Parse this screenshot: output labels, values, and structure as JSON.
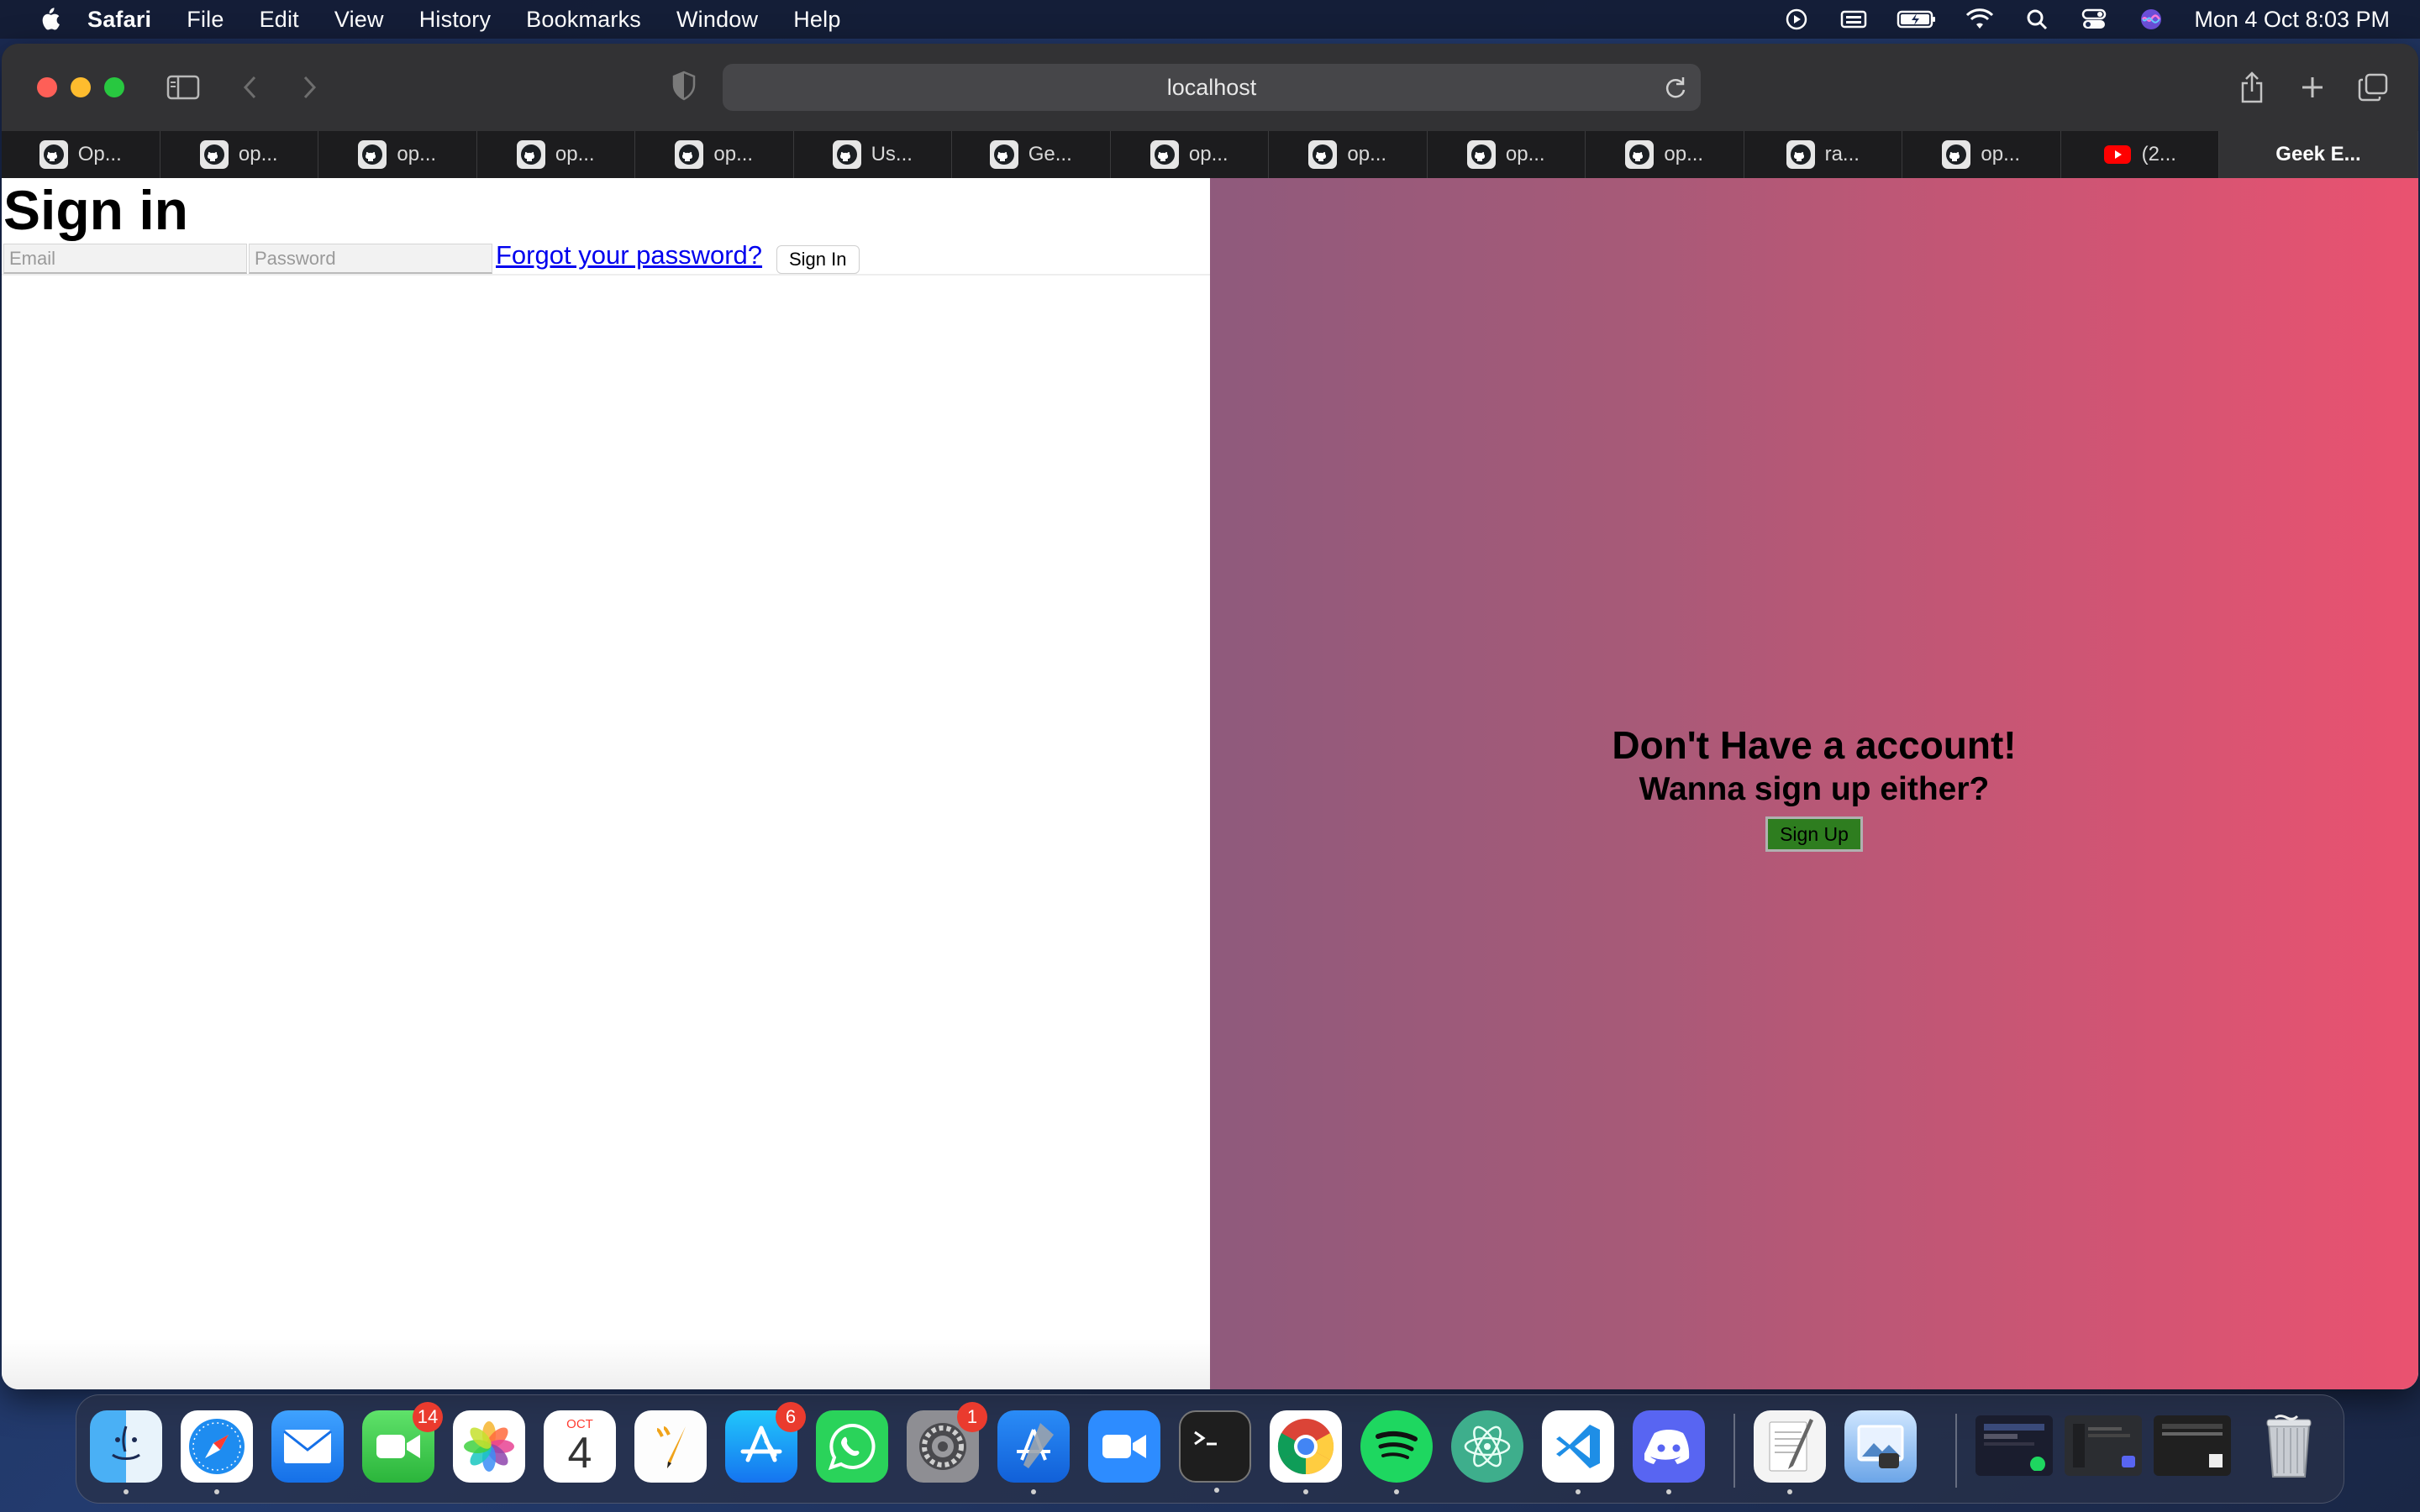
{
  "menubar": {
    "app_name": "Safari",
    "items": [
      "File",
      "Edit",
      "View",
      "History",
      "Bookmarks",
      "Window",
      "Help"
    ],
    "clock": "Mon 4 Oct  8:03 PM",
    "status_icons": [
      "screen-record-icon",
      "keyboard-input-icon",
      "battery-charging-icon",
      "wifi-icon",
      "spotlight-search-icon",
      "control-center-icon",
      "siri-icon"
    ]
  },
  "browser": {
    "address": "localhost",
    "tabs": [
      {
        "label": "Op...",
        "icon": "github-icon"
      },
      {
        "label": "op...",
        "icon": "github-icon"
      },
      {
        "label": "op...",
        "icon": "github-icon"
      },
      {
        "label": "op...",
        "icon": "github-icon"
      },
      {
        "label": "op...",
        "icon": "github-icon"
      },
      {
        "label": "Us...",
        "icon": "github-icon"
      },
      {
        "label": "Ge...",
        "icon": "github-icon"
      },
      {
        "label": "op...",
        "icon": "github-icon"
      },
      {
        "label": "op...",
        "icon": "github-icon"
      },
      {
        "label": "op...",
        "icon": "github-icon"
      },
      {
        "label": "op...",
        "icon": "github-icon"
      },
      {
        "label": "ra...",
        "icon": "github-icon"
      },
      {
        "label": "op...",
        "icon": "github-icon"
      },
      {
        "label": "(2...",
        "icon": "youtube-icon"
      }
    ],
    "active_tab": "Geek E..."
  },
  "page": {
    "signin": {
      "title": "Sign in",
      "email_placeholder": "Email",
      "password_placeholder": "Password",
      "forgot_link": "Forgot your password?",
      "signin_button": "Sign In"
    },
    "signup_promo": {
      "heading": "Don't Have a account!",
      "subheading": "Wanna sign up either?",
      "signup_button": "Sign Up"
    }
  },
  "dock": {
    "apps": [
      {
        "name": "Finder",
        "icon": "finder-icon",
        "running": true
      },
      {
        "name": "Safari",
        "icon": "safari-icon",
        "running": true
      },
      {
        "name": "Mail",
        "icon": "mail-icon"
      },
      {
        "name": "FaceTime",
        "icon": "facetime-icon",
        "badge": "14"
      },
      {
        "name": "Photos",
        "icon": "photos-icon"
      },
      {
        "name": "Calendar",
        "icon": "calendar-icon",
        "month": "OCT",
        "day": "4"
      },
      {
        "name": "Pages",
        "icon": "pages-icon"
      },
      {
        "name": "App Store",
        "icon": "app-store-icon",
        "badge": "6"
      },
      {
        "name": "WhatsApp",
        "icon": "whatsapp-icon"
      },
      {
        "name": "System Preferences",
        "icon": "system-preferences-icon",
        "badge": "1"
      },
      {
        "name": "Xcode",
        "icon": "xcode-icon",
        "running": true
      },
      {
        "name": "Zoom",
        "icon": "zoom-icon"
      },
      {
        "name": "Terminal",
        "icon": "terminal-icon",
        "running": true
      },
      {
        "name": "Chrome",
        "icon": "chrome-icon",
        "running": true
      },
      {
        "name": "Spotify",
        "icon": "spotify-icon",
        "running": true
      },
      {
        "name": "Atom",
        "icon": "atom-icon"
      },
      {
        "name": "VS Code",
        "icon": "vscode-icon",
        "running": true
      },
      {
        "name": "Discord",
        "icon": "discord-icon",
        "running": true
      },
      {
        "name": "TextEdit",
        "icon": "textedit-icon",
        "running": true
      },
      {
        "name": "Preview",
        "icon": "preview-icon"
      },
      {
        "name": "Trash",
        "icon": "trash-icon"
      }
    ]
  }
}
